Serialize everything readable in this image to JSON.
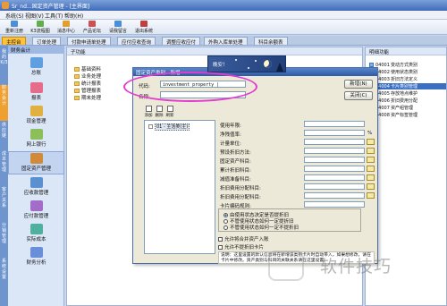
{
  "window": {
    "title": "Sr_nd...固定资产管理 - [主界面]"
  },
  "menu": [
    "系统(S)",
    "视图(V)",
    "工具(T)",
    "帮助(H)"
  ],
  "toolbar": [
    {
      "label": "重新注册",
      "color": "#4a90d9"
    },
    {
      "label": "K3流程图",
      "color": "#5fb04a"
    },
    {
      "label": "消息中心",
      "color": "#e0a030"
    },
    {
      "label": "产品论坛",
      "color": "#d05050"
    },
    {
      "label": "请我留言",
      "color": "#4a90d9"
    },
    {
      "label": "退出系统",
      "color": "#c04040"
    }
  ],
  "tabs": [
    {
      "label": "主控台",
      "active": true
    },
    {
      "label": "订单处理",
      "active": false
    },
    {
      "label": "付款申请单处理",
      "active": false
    },
    {
      "label": "应付应收查询",
      "active": false
    },
    {
      "label": "调整应收应付",
      "active": false
    },
    {
      "label": "外购入库单处理",
      "active": false
    },
    {
      "label": "科目余额表",
      "active": false
    }
  ],
  "left_vtabs": [
    {
      "label": "我的K/3",
      "active": false
    },
    {
      "label": "财务会计",
      "active": true
    },
    {
      "label": "供应链",
      "active": false
    },
    {
      "label": "成本管理",
      "active": false
    },
    {
      "label": "客户关系",
      "active": false
    },
    {
      "label": "分销管理",
      "active": false
    },
    {
      "label": "系统设置",
      "active": false
    }
  ],
  "nav_panel": {
    "header": "财务会计",
    "items": [
      {
        "label": "总账",
        "color": "#5f9fe0",
        "selected": false
      },
      {
        "label": "报表",
        "color": "#e56c8a",
        "selected": false
      },
      {
        "label": "现金管理",
        "color": "#e0b040",
        "selected": false
      },
      {
        "label": "网上银行",
        "color": "#8cbf5a",
        "selected": false
      },
      {
        "label": "固定资产管理",
        "color": "#d08a3a",
        "selected": true
      },
      {
        "label": "应收款管理",
        "color": "#5a8fd0",
        "selected": false
      },
      {
        "label": "应付款管理",
        "color": "#a26cc8",
        "selected": false
      },
      {
        "label": "实际成本",
        "color": "#4fb0a0",
        "selected": false
      },
      {
        "label": "财务分析",
        "color": "#6a8fd8",
        "selected": false
      }
    ]
  },
  "sub_pane": {
    "header": "子功能",
    "tree": [
      "基础资料",
      "业务处理",
      "统计报表",
      "管理报表",
      "期末处理"
    ]
  },
  "detail_pane": {
    "header": "明细功能",
    "rows": [
      {
        "code": "04001",
        "label": "变动方式类别",
        "selected": false
      },
      {
        "code": "04002",
        "label": "使用状态类别",
        "selected": false
      },
      {
        "code": "04003",
        "label": "折旧方法定义",
        "selected": false
      },
      {
        "code": "04004",
        "label": "卡片类别管理",
        "selected": true
      },
      {
        "code": "04005",
        "label": "存放地点维护",
        "selected": false
      },
      {
        "code": "04006",
        "label": "折旧费用分配",
        "selected": false
      },
      {
        "code": "04007",
        "label": "资产组管理",
        "selected": false
      },
      {
        "code": "04008",
        "label": "资产标签管理",
        "selected": false
      }
    ]
  },
  "dialog": {
    "title": "固定资产类别 - 新增",
    "code_label": "代码:",
    "code_value": "investment property |",
    "name_label": "名称:",
    "name_value": "",
    "new_button": "新增(N)",
    "close_button": "关闭(C)",
    "mini_toolbar": [
      "添加",
      "删除",
      "刷新"
    ],
    "tree_root": "01 - 主活类(主)",
    "props": [
      {
        "label": "使用年限:",
        "pick": false
      },
      {
        "label": "净残值率:",
        "pick": false,
        "suffix": "%"
      },
      {
        "label": "计量单位:",
        "pick": true
      },
      {
        "label": "预设折旧方法:",
        "pick": true
      },
      {
        "label": "固定资产科目:",
        "pick": true
      },
      {
        "label": "累计折旧科目:",
        "pick": true
      },
      {
        "label": "减值准备科目:",
        "pick": true
      },
      {
        "label": "折旧费用分配科目:",
        "pick": true
      },
      {
        "label": "折旧费用分配科目:",
        "pick": true
      },
      {
        "label": "卡片编码规则:",
        "pick": false
      }
    ],
    "radios": [
      {
        "label": "由使用状态决定是否提折旧",
        "on": true
      },
      {
        "label": "不管使用状态如何一定提折旧",
        "on": false
      },
      {
        "label": "不管使用状态如何一定不提折旧",
        "on": false
      }
    ],
    "checks": [
      "允许将合并资产入账",
      "允许不提折旧卡片"
    ],
    "note": "说明：这里设置的默认信息将在新增该类别卡片时自动带入，如果想修改，请在卡片中修改。资产类别与科目的关联关系请在这里设置。"
  },
  "night_widget": {
    "text": "晚安！"
  },
  "watermark": {
    "text": "软件技巧"
  },
  "colors": {
    "accent": "#ffc23a",
    "title_bar": "#3f6cb8",
    "highlight_ellipse": "#e33ad0",
    "selection": "#3a6fc4"
  }
}
